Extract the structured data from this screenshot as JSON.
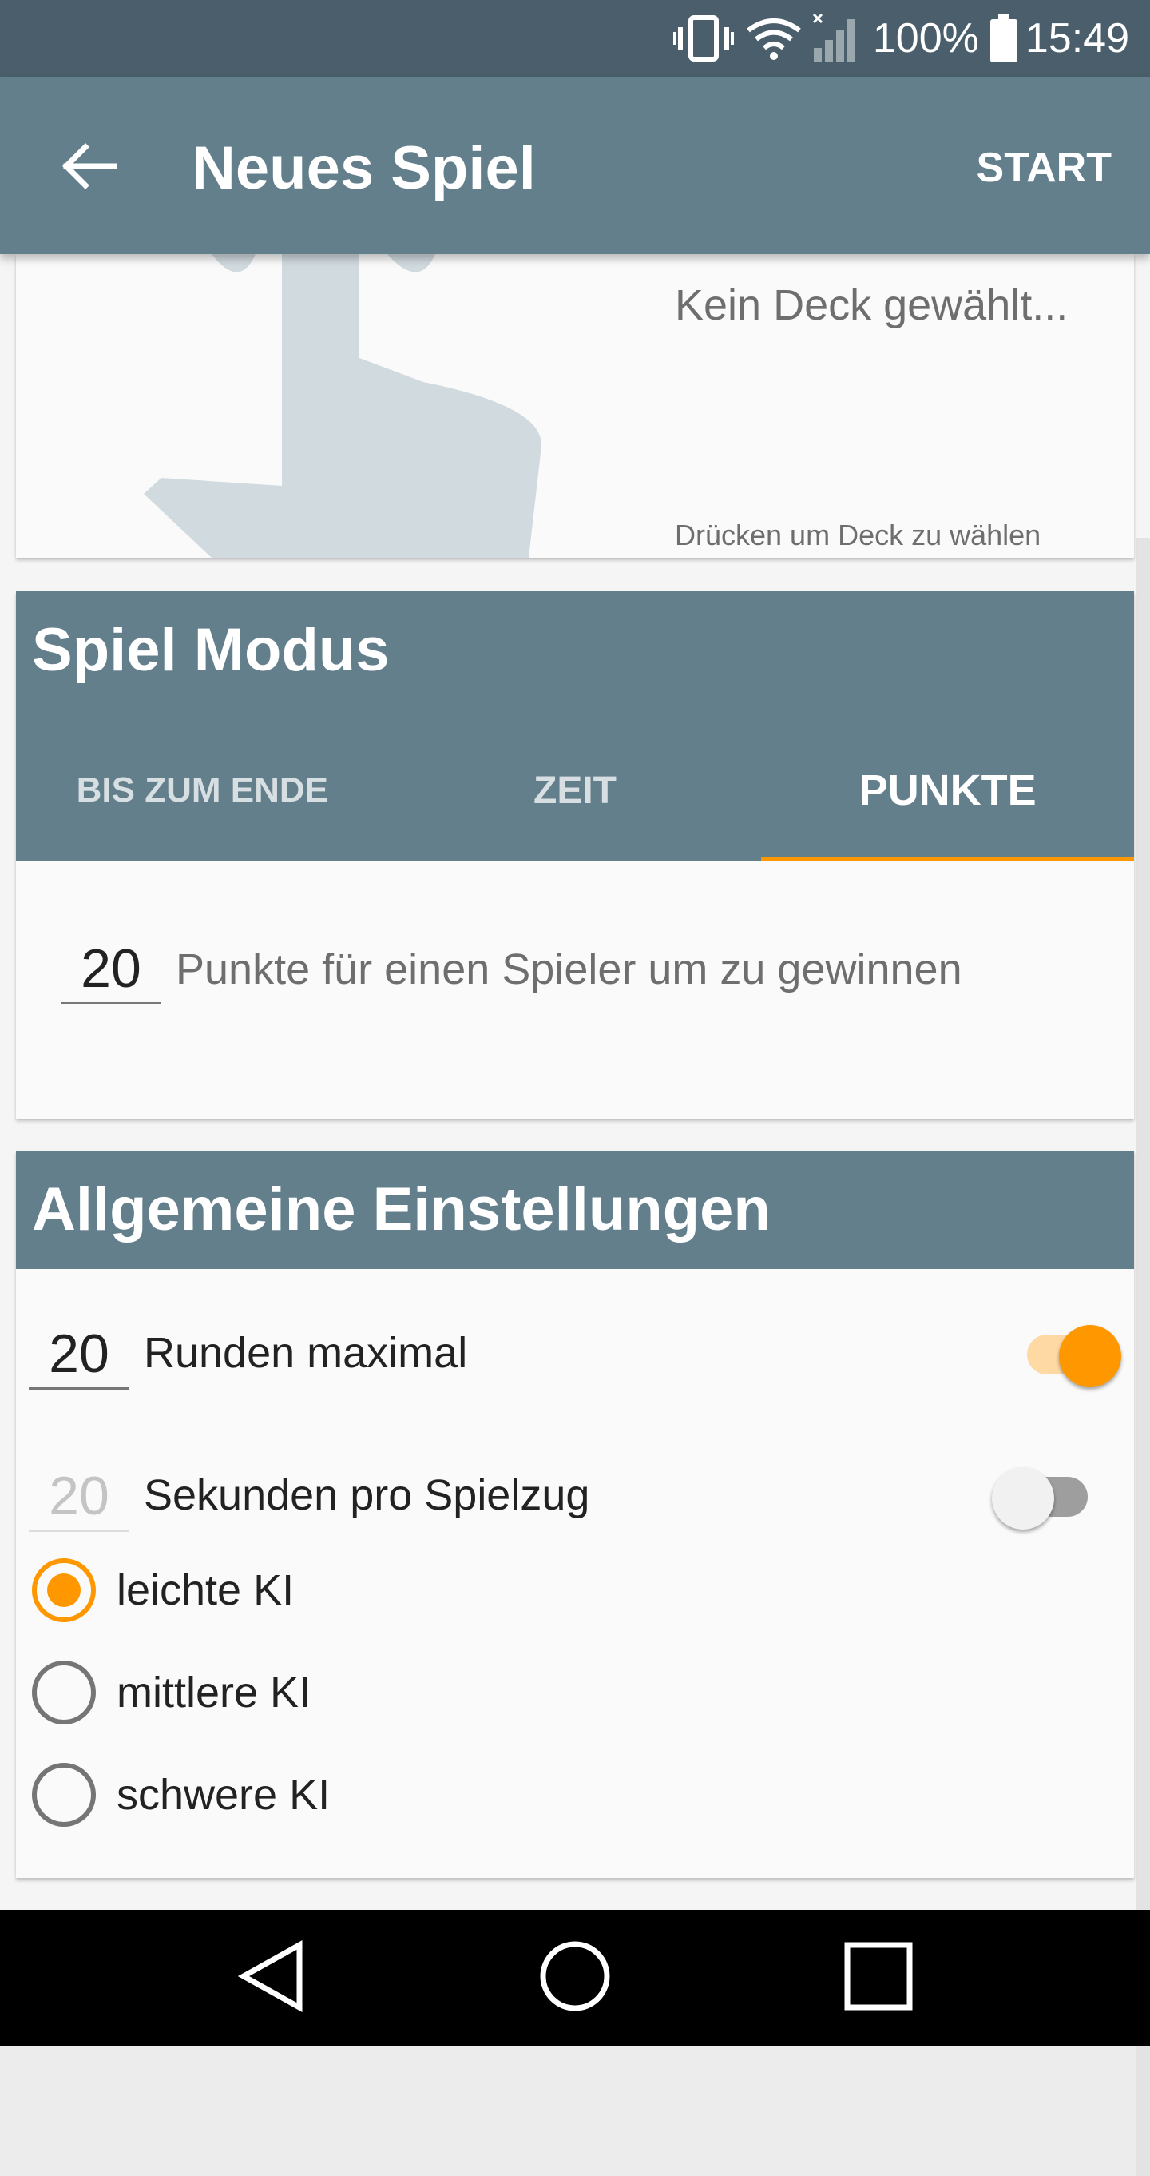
{
  "status_bar": {
    "battery": "100%",
    "time": "15:49"
  },
  "app_bar": {
    "title": "Neues Spiel",
    "action": "START"
  },
  "deck": {
    "name": "Kein Deck gewählt...",
    "hint": "Drücken um Deck zu wählen"
  },
  "mode": {
    "title": "Spiel Modus",
    "tabs": [
      "BIS ZUM ENDE",
      "ZEIT",
      "PUNKTE"
    ],
    "selected_tab": "PUNKTE",
    "points_value": "20",
    "points_label": "Punkte für einen Spieler um zu gewinnen"
  },
  "general": {
    "title": "Allgemeine Einstellungen",
    "rounds_value": "20",
    "rounds_label": "Runden maximal",
    "rounds_enabled": true,
    "seconds_value": "20",
    "seconds_label": "Sekunden pro Spielzug",
    "seconds_enabled": false,
    "ai_levels": [
      "leichte KI",
      "mittlere KI",
      "schwere KI"
    ],
    "selected_ai": "leichte KI"
  },
  "colors": {
    "primary": "#637f8c",
    "status": "#4a5f6b",
    "accent": "#ff9800"
  }
}
